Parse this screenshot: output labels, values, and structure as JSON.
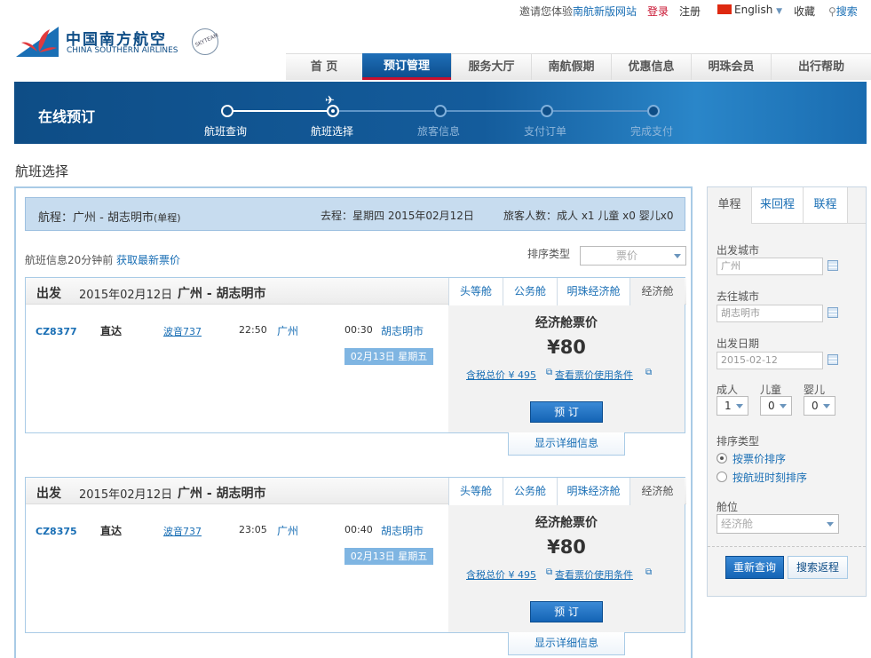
{
  "topbar": {
    "invite": "邀请您体验",
    "new_site": "南航新版网站",
    "login": "登录",
    "register": "注册",
    "language": "English",
    "favorites": "收藏",
    "search": "搜索"
  },
  "logo": {
    "cn": "中国南方航空",
    "en": "CHINA SOUTHERN AIRLINES",
    "skyteam": "SKYTEAM"
  },
  "nav": [
    "首 页",
    "预订管理",
    "服务大厅",
    "南航假期",
    "优惠信息",
    "明珠会员",
    "出行帮助"
  ],
  "banner": {
    "title": "在线预订",
    "steps": [
      "航班查询",
      "航班选择",
      "旅客信息",
      "支付订单",
      "完成支付"
    ]
  },
  "section_title": "航班选择",
  "route": {
    "trip": "航程：广州 - 胡志明市",
    "trip_type": "(单程)",
    "date": "去程：星期四 2015年02月12日",
    "passengers": "旅客人数：成人 x1 儿童 x0 婴儿x0"
  },
  "info": {
    "age": "航班信息20分钟前",
    "refresh": "获取最新票价",
    "sort_label": "排序类型",
    "sort_value": "票价"
  },
  "flights": [
    {
      "head_label": "出发",
      "date": "2015年02月12日",
      "route": "广州 - 胡志明市",
      "tabs": [
        "头等舱",
        "公务舱",
        "明珠经济舱",
        "经济舱"
      ],
      "number": "CZ8377",
      "type": "直达",
      "aircraft": "波音737",
      "dep_time": "22:50",
      "dep_city": "广州",
      "arr_time": "00:30",
      "arr_city": "胡志明市",
      "arr_date": "02月13日 星期五",
      "price_title": "经济舱票价",
      "price": "¥80",
      "tax": "含税总价 ¥ 495",
      "rules": "查看票价使用条件",
      "book": "预 订",
      "detail": "显示详细信息"
    },
    {
      "head_label": "出发",
      "date": "2015年02月12日",
      "route": "广州 - 胡志明市",
      "tabs": [
        "头等舱",
        "公务舱",
        "明珠经济舱",
        "经济舱"
      ],
      "number": "CZ8375",
      "type": "直达",
      "aircraft": "波音737",
      "dep_time": "23:05",
      "dep_city": "广州",
      "arr_time": "00:40",
      "arr_city": "胡志明市",
      "arr_date": "02月13日 星期五",
      "price_title": "经济舱票价",
      "price": "¥80",
      "tax": "含税总价 ¥ 495",
      "rules": "查看票价使用条件",
      "book": "预 订",
      "detail": "显示详细信息"
    }
  ],
  "sidebar": {
    "tabs": [
      "单程",
      "来回程",
      "联程"
    ],
    "from_label": "出发城市",
    "from_value": "广州",
    "to_label": "去往城市",
    "to_value": "胡志明市",
    "date_label": "出发日期",
    "date_value": "2015-02-12",
    "adult_label": "成人",
    "child_label": "儿童",
    "infant_label": "婴儿",
    "adult": "1",
    "child": "0",
    "infant": "0",
    "sort_label": "排序类型",
    "sort_price": "按票价排序",
    "sort_time": "按航班时刻排序",
    "cabin_label": "舱位",
    "cabin_value": "经济舱",
    "requery": "重新查询",
    "search_return": "搜索返程"
  },
  "colors": {
    "brand_blue": "#0e4d86",
    "link_blue": "#1a6fb5",
    "accent_red": "#c8102e"
  }
}
